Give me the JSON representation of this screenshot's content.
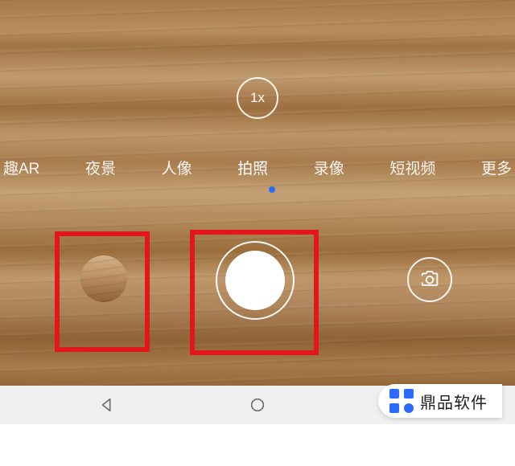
{
  "zoom": {
    "label": "1x"
  },
  "modes": [
    {
      "label": "趣AR",
      "active": false
    },
    {
      "label": "夜景",
      "active": false
    },
    {
      "label": "人像",
      "active": false
    },
    {
      "label": "拍照",
      "active": true
    },
    {
      "label": "录像",
      "active": false
    },
    {
      "label": "短视频",
      "active": false
    },
    {
      "label": "更多",
      "active": false
    }
  ],
  "watermark": {
    "text": "鼎品软件"
  },
  "colors": {
    "accent": "#2b6cff",
    "highlight": "#e2171a"
  }
}
